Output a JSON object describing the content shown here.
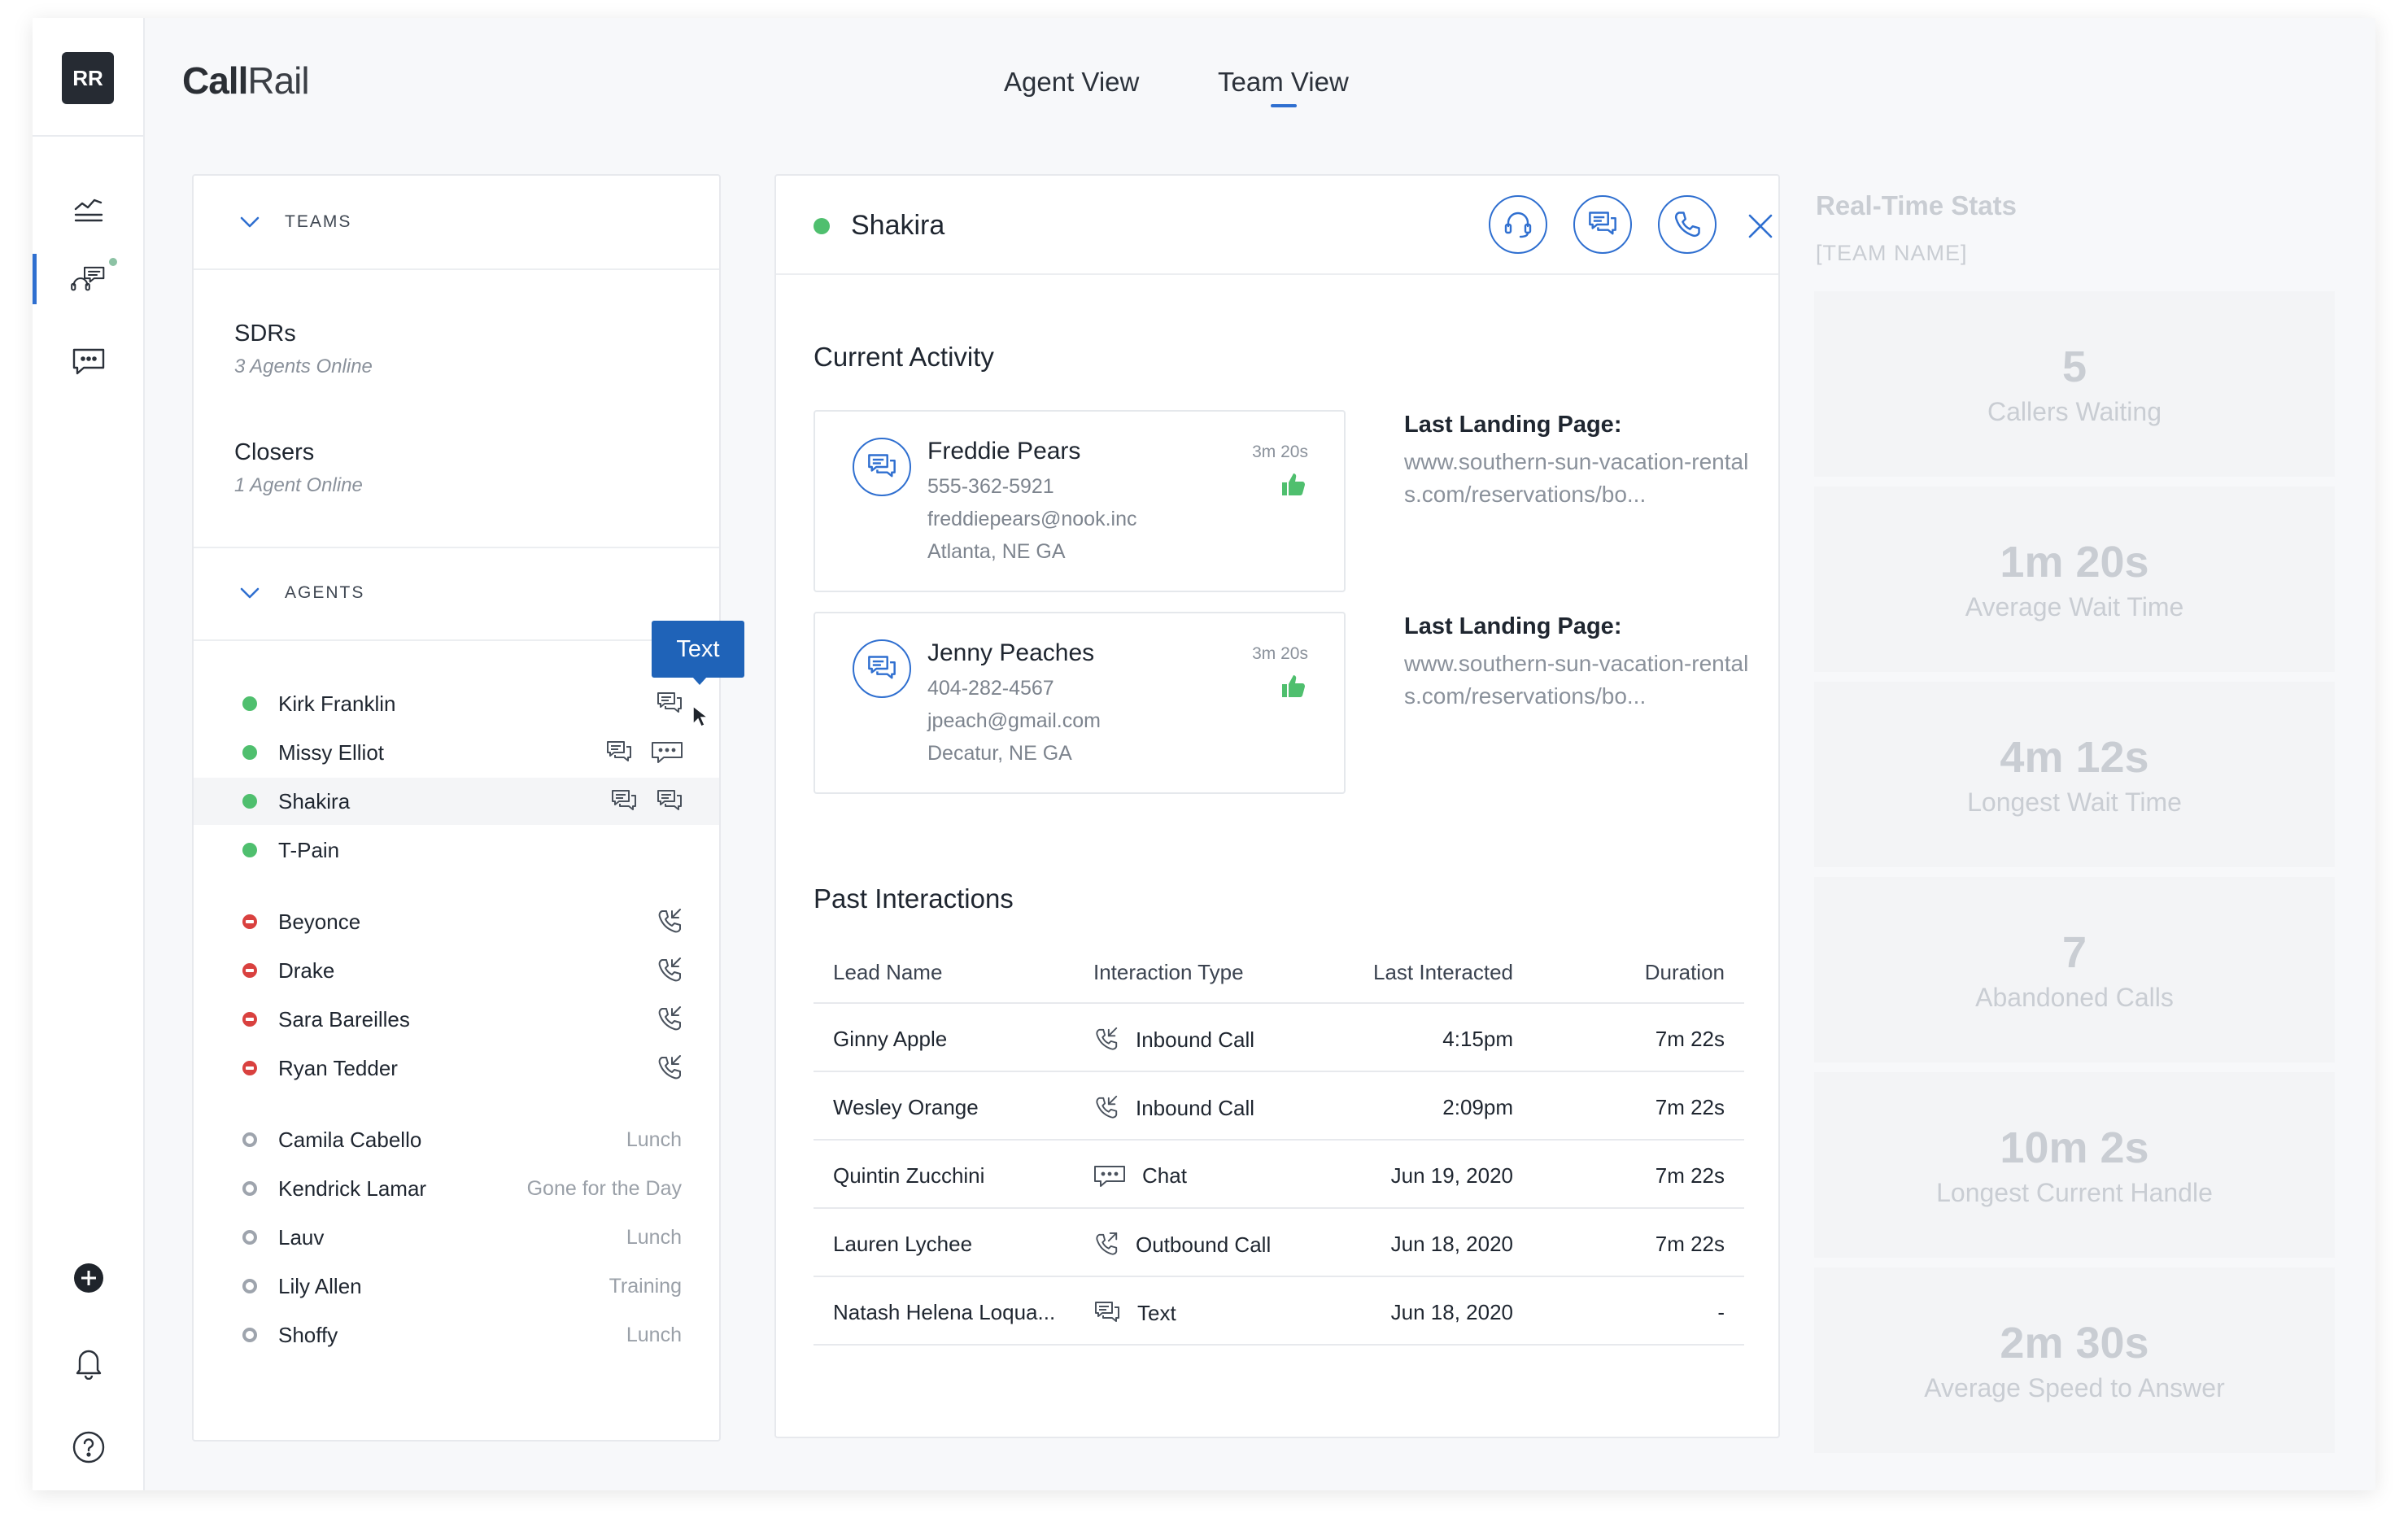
{
  "user": {
    "initials": "RR"
  },
  "brand": {
    "bold": "Call",
    "rest": "Rail"
  },
  "views": {
    "agent": "Agent View",
    "team": "Team View",
    "active": "team"
  },
  "teams_section": {
    "heading": "TEAMS",
    "teams": [
      {
        "name": "SDRs",
        "sub": "3 Agents Online"
      },
      {
        "name": "Closers",
        "sub": "1 Agent Online"
      }
    ]
  },
  "agents_section": {
    "heading": "AGENTS",
    "tooltip": "Text",
    "agents": [
      {
        "name": "Kirk Franklin",
        "state": "online",
        "icons": [
          "text-icon"
        ]
      },
      {
        "name": "Missy Elliot",
        "state": "online",
        "icons": [
          "text-icon",
          "chat-icon"
        ]
      },
      {
        "name": "Shakira",
        "state": "online",
        "icons": [
          "text-icon",
          "text-icon"
        ]
      },
      {
        "name": "T-Pain",
        "state": "online",
        "icons": []
      },
      {
        "name": "Beyonce",
        "state": "busy",
        "icons": [
          "inbound-call-icon"
        ]
      },
      {
        "name": "Drake",
        "state": "busy",
        "icons": [
          "inbound-call-icon"
        ]
      },
      {
        "name": "Sara Bareilles",
        "state": "busy",
        "icons": [
          "inbound-call-icon"
        ]
      },
      {
        "name": "Ryan Tedder",
        "state": "busy",
        "icons": [
          "inbound-call-icon"
        ]
      },
      {
        "name": "Camila Cabello",
        "state": "away",
        "status": "Lunch"
      },
      {
        "name": "Kendrick Lamar",
        "state": "away",
        "status": "Gone for the Day"
      },
      {
        "name": "Lauv",
        "state": "away",
        "status": "Lunch"
      },
      {
        "name": "Lily Allen",
        "state": "away",
        "status": "Training"
      },
      {
        "name": "Shoffy",
        "state": "away",
        "status": "Lunch"
      }
    ]
  },
  "detail": {
    "agent_name": "Shakira",
    "current_activity_title": "Current Activity",
    "activities": [
      {
        "name": "Freddie Pears",
        "phone": "555-362-5921",
        "email": "freddiepears@nook.inc",
        "location": "Atlanta, NE GA",
        "time": "3m 20s",
        "landing_label": "Last Landing Page:",
        "landing_url": "www.southern-sun-vacation-rentals.com/reservations/bo..."
      },
      {
        "name": "Jenny Peaches",
        "phone": "404-282-4567",
        "email": "jpeach@gmail.com",
        "location": "Decatur, NE GA",
        "time": "3m 20s",
        "landing_label": "Last Landing Page:",
        "landing_url": "www.southern-sun-vacation-rentals.com/reservations/bo..."
      }
    ],
    "past_title": "Past Interactions",
    "table": {
      "headers": [
        "Lead Name",
        "Interaction Type",
        "Last Interacted",
        "Duration"
      ],
      "rows": [
        {
          "lead": "Ginny Apple",
          "type": "Inbound Call",
          "icon": "inbound-call-icon",
          "last": "4:15pm",
          "duration": "7m 22s"
        },
        {
          "lead": "Wesley Orange",
          "type": "Inbound Call",
          "icon": "inbound-call-icon",
          "last": "2:09pm",
          "duration": "7m 22s"
        },
        {
          "lead": "Quintin Zucchini",
          "type": "Chat",
          "icon": "chat-icon",
          "last": "Jun 19, 2020",
          "duration": "7m 22s"
        },
        {
          "lead": "Lauren Lychee",
          "type": "Outbound Call",
          "icon": "outbound-call-icon",
          "last": "Jun 18, 2020",
          "duration": "7m 22s"
        },
        {
          "lead": "Natash Helena Loqua...",
          "type": "Text",
          "icon": "text-icon",
          "last": "Jun 18, 2020",
          "duration": "-"
        }
      ]
    }
  },
  "stats": {
    "title": "Real-Time Stats",
    "team": "[TEAM NAME]",
    "items": [
      {
        "value": "5",
        "label": "Callers Waiting"
      },
      {
        "value": "1m 20s",
        "label": "Average Wait Time"
      },
      {
        "value": "4m 12s",
        "label": "Longest Wait Time"
      },
      {
        "value": "7",
        "label": "Abandoned Calls"
      },
      {
        "value": "10m 2s",
        "label": "Longest Current Handle"
      },
      {
        "value": "2m 30s",
        "label": "Average Speed to Answer"
      }
    ]
  },
  "colors": {
    "accent": "#2f6fd0",
    "online": "#4fbf6e",
    "busy": "#d9413f",
    "tooltip": "#1f63b8"
  }
}
